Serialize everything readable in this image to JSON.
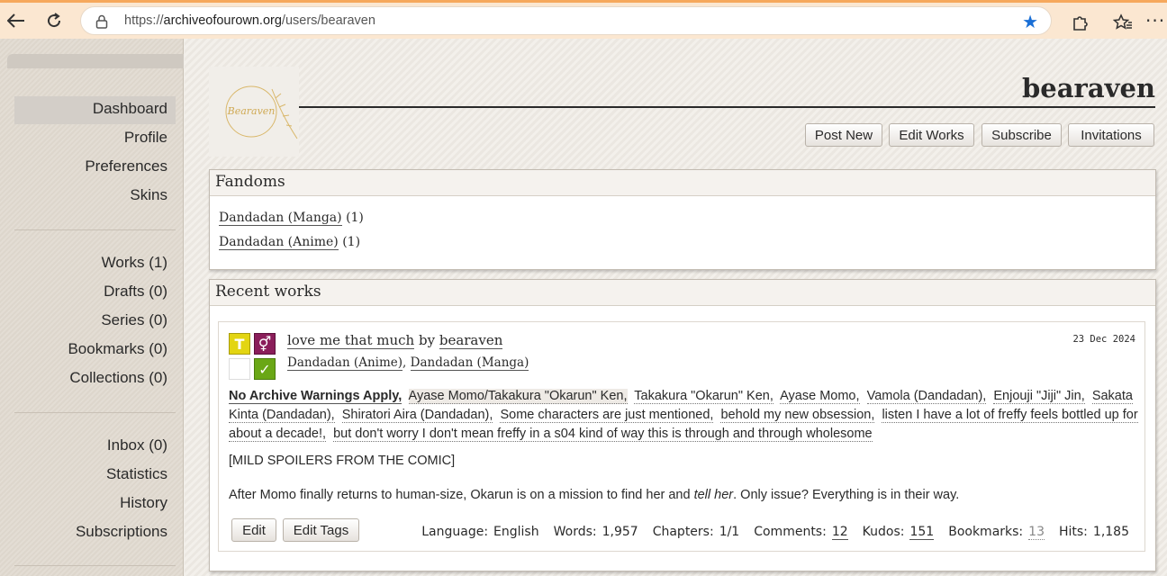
{
  "browser": {
    "url_prefix": "https://",
    "url_host": "archiveofourown.org",
    "url_path": "/users/bearaven"
  },
  "sidebar": {
    "group1": [
      "Dashboard",
      "Profile",
      "Preferences",
      "Skins"
    ],
    "group2": [
      "Works (1)",
      "Drafts (0)",
      "Series (0)",
      "Bookmarks (0)",
      "Collections (0)"
    ],
    "group3": [
      "Inbox (0)",
      "Statistics",
      "History",
      "Subscriptions"
    ],
    "active": "Dashboard"
  },
  "header": {
    "username": "bearaven",
    "avatar_text": "Bearaven",
    "buttons": [
      "Post New",
      "Edit Works",
      "Subscribe",
      "Invitations"
    ]
  },
  "fandoms": {
    "title": "Fandoms",
    "items": [
      {
        "name": "Dandadan (Manga)",
        "count": "(1)"
      },
      {
        "name": "Dandadan (Anime)",
        "count": "(1)"
      }
    ]
  },
  "recent": {
    "title": "Recent works",
    "work": {
      "title": "love me that much",
      "by": "by",
      "author": "bearaven",
      "date": "23 Dec 2024",
      "fandoms": "Dandadan (Anime), Dandadan (Manga)",
      "fandom1": "Dandadan (Anime)",
      "fandom2": "Dandadan (Manga)",
      "comma": ",",
      "icons": {
        "rating": "T",
        "category": "⚥",
        "complete": "✓"
      },
      "warning": "No Archive Warnings Apply,",
      "tags": [
        "Ayase Momo/Takakura \"Okarun\" Ken,",
        "Takakura \"Okarun\" Ken,",
        "Ayase Momo,",
        "Vamola (Dandadan),",
        "Enjouji \"Jiji\" Jin,",
        "Sakata Kinta (Dandadan),",
        "Shiratori Aira (Dandadan),",
        "Some characters are just mentioned,",
        "behold my new obsession,",
        "listen I have a lot of freffy feels bottled up for about a decade!,",
        "but don't worry I don't mean freffy in a s04 kind of way this is through and through wholesome"
      ],
      "summary_note": "[MILD SPOILERS FROM THE COMIC]",
      "summary_a": "After Momo finally returns to human-size, Okarun is on a mission to find her and ",
      "summary_em": "tell her",
      "summary_b": ". Only issue? Everything is in their way.",
      "actions": [
        "Edit",
        "Edit Tags"
      ],
      "stats": {
        "language_label": "Language:",
        "language": "English",
        "words_label": "Words:",
        "words": "1,957",
        "chapters_label": "Chapters:",
        "chapters": "1/1",
        "comments_label": "Comments:",
        "comments": "12",
        "kudos_label": "Kudos:",
        "kudos": "151",
        "bookmarks_label": "Bookmarks:",
        "bookmarks": "13",
        "hits_label": "Hits:",
        "hits": "1,185"
      }
    }
  },
  "colors": {
    "rating_teen": "#e3d512",
    "category_multi": "#8a1e5a",
    "complete_green": "#6aa716",
    "star_blue": "#1a6fd6"
  }
}
